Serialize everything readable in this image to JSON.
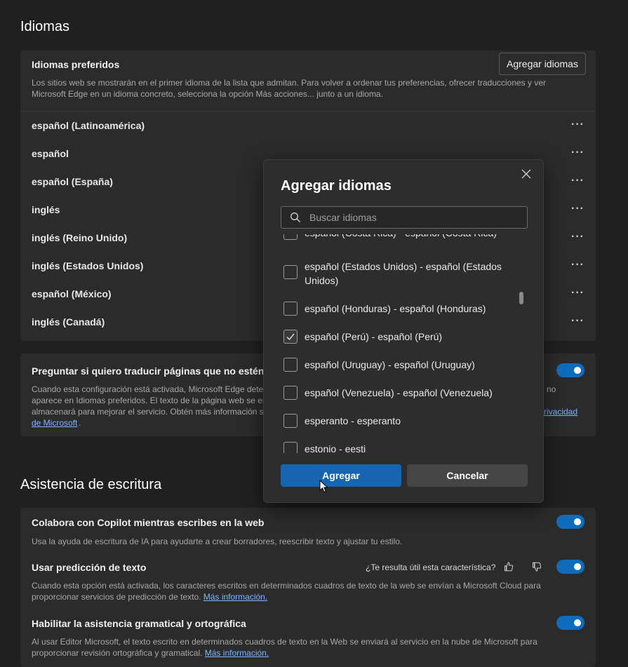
{
  "idiomas": {
    "section_title": "Idiomas",
    "preferred_title": "Idiomas preferidos",
    "preferred_desc": "Los sitios web se mostrarán en el primer idioma de la lista que admitan. Para volver a ordenar tus preferencias, ofrecer traducciones y ver Microsoft Edge en un idioma concreto, selecciona la opción Más acciones... junto a un idioma.",
    "add_button": "Agregar idiomas",
    "more_actions": "···",
    "languages": [
      "español (Latinoamérica)",
      "español",
      "español (España)",
      "inglés",
      "inglés (Reino Unido)",
      "inglés (Estados Unidos)",
      "español (México)",
      "inglés (Canadá)"
    ]
  },
  "translate": {
    "title": "Preguntar si quiero traducir páginas que no estén en",
    "desc_line1": "Cuando esta configuración está activada, Microsoft Edge detec",
    "desc_line1_right": "no",
    "desc_line2": "aparece en Idiomas preferidos. El texto de la página web se en",
    "desc_line3": "almacenará para mejorar el servicio. Obtén más información so",
    "desc_link_right": "rivacidad",
    "desc_link_line4": "de Microsoft",
    "desc_end": "."
  },
  "writing": {
    "section_title": "Asistencia de escritura",
    "copilot_title": "Colabora con Copilot mientras escribes en la web",
    "copilot_desc": "Usa la ayuda de escritura de IA para ayudarte a crear borradores, reescribir texto y ajustar tu estilo.",
    "prediction_title": "Usar predicción de texto",
    "feedback_question": "¿Te resulta útil esta característica?",
    "prediction_desc": "Cuando esta opción está activada, los caracteres escritos en determinados cuadros de texto de la web se envían a Microsoft Cloud para proporcionar servicios de predicción de texto.",
    "prediction_link": "Más información.",
    "grammar_title": "Habilitar la asistencia gramatical y ortográfica",
    "grammar_desc": "Al usar Editor Microsoft, el texto escrito en determinados cuadros de texto en la Web se enviará al servicio en la nube de Microsoft para proporcionar revisión ortográfica y gramatical.",
    "grammar_link": "Más información."
  },
  "dialog": {
    "title": "Agregar idiomas",
    "search_placeholder": "Buscar idiomas",
    "options": [
      {
        "label": "español (Costa Rica) - español (Costa Rica)",
        "checked": false
      },
      {
        "label": "español (Estados Unidos) - español (Estados Unidos)",
        "checked": false
      },
      {
        "label": "español (Honduras) - español (Honduras)",
        "checked": false
      },
      {
        "label": "español (Perú) - español (Perú)",
        "checked": true
      },
      {
        "label": "español (Uruguay) - español (Uruguay)",
        "checked": false
      },
      {
        "label": "español (Venezuela) - español (Venezuela)",
        "checked": false
      },
      {
        "label": "esperanto - esperanto",
        "checked": false
      },
      {
        "label": "estonio - eesti",
        "checked": false
      }
    ],
    "add_button": "Agregar",
    "cancel_button": "Cancelar"
  },
  "colors": {
    "accent": "#0f6cbd",
    "background": "#202020",
    "card": "#2b2b2b",
    "link": "#7eb6ff"
  }
}
